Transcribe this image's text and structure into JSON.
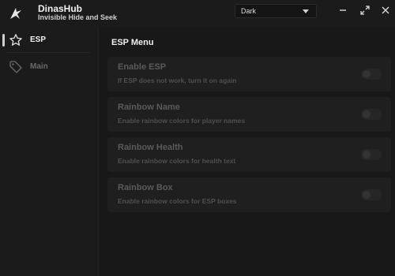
{
  "app": {
    "title": "DinasHub",
    "subtitle": "Invisible Hide and Seek"
  },
  "theme": {
    "selected": "Dark"
  },
  "window_controls": {
    "minimize_icon": "minimize-icon",
    "maximize_icon": "maximize-icon",
    "close_icon": "close-icon"
  },
  "sidebar": {
    "items": [
      {
        "label": "ESP",
        "icon": "star-icon",
        "active": true
      },
      {
        "label": "Main",
        "icon": "tag-icon",
        "active": false
      }
    ]
  },
  "main": {
    "title": "ESP Menu",
    "options": [
      {
        "title": "Enable ESP",
        "description": "If ESP does not work, turn it on again",
        "enabled": false
      },
      {
        "title": "Rainbow Name",
        "description": "Enable rainbow colors for player names",
        "enabled": false
      },
      {
        "title": "Rainbow Health",
        "description": "Enable rainbow colors for health text",
        "enabled": false
      },
      {
        "title": "Rainbow Box",
        "description": "Enable rainbow colors for ESP boxes",
        "enabled": false
      }
    ]
  },
  "colors": {
    "background": "#1b1b1b",
    "card": "#1f1f1f",
    "text": "#e8e8e8",
    "muted_text": "#5a5a5a"
  }
}
